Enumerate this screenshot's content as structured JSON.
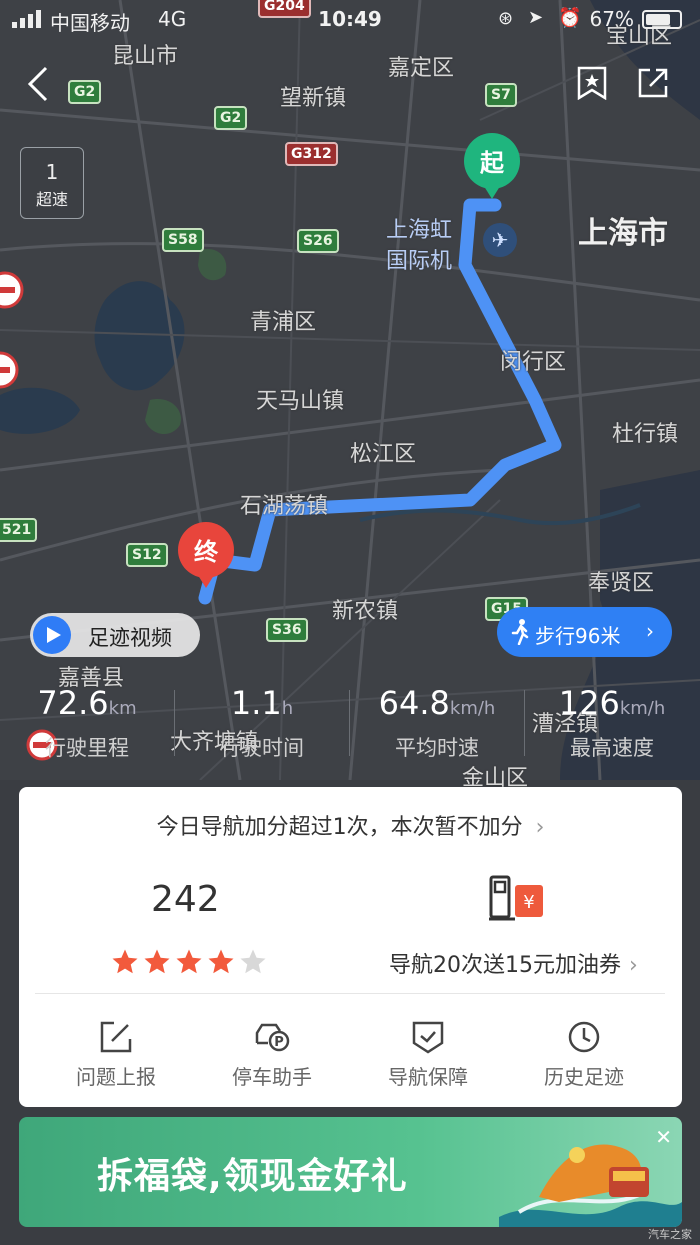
{
  "status_bar": {
    "carrier": "中国移动",
    "network": "4G",
    "time": "10:49",
    "battery": "67%"
  },
  "map": {
    "places": {
      "kunshan": "昆山市",
      "jiading": "嘉定区",
      "baoshan": "宝山区",
      "wangxin": "望新镇",
      "hongqiao_1": "上海虹",
      "hongqiao_2": "国际机",
      "shanghai": "上海市",
      "qingpu": "青浦区",
      "minhang": "闵行区",
      "tianmashan": "天马山镇",
      "songjiang": "松江区",
      "duhang": "杜行镇",
      "shihudang": "石湖荡镇",
      "xinnong": "新农镇",
      "fengxian": "奉贤区",
      "jiashan": "嘉善县",
      "daqiao": "大齐塘镇",
      "caojing": "漕泾镇",
      "jinshan": "金山区"
    },
    "highways": {
      "g2a": "G2",
      "g2b": "G2",
      "g204": "G204",
      "s7": "S7",
      "g312": "G312",
      "s58": "S58",
      "s26": "S26",
      "s521": "521",
      "s12": "S12",
      "s36": "S36",
      "g15": "G15"
    },
    "start_label": "起",
    "end_label": "终",
    "speed_box": {
      "count": "1",
      "label": "超速"
    },
    "video_pill": "足迹视频",
    "walk_pill": "步行96米"
  },
  "stats": [
    {
      "value": "72.6",
      "unit": "km",
      "label": "行驶里程"
    },
    {
      "value": "1.1",
      "unit": "h",
      "label": "行驶时间"
    },
    {
      "value": "64.8",
      "unit": "km/h",
      "label": "平均时速"
    },
    {
      "value": "126",
      "unit": "km/h",
      "label": "最高速度"
    }
  ],
  "card": {
    "notice": "今日导航加分超过1次，本次暂不加分",
    "score": "242",
    "stars_rating": 4,
    "stars_total": 5,
    "coupon": "导航20次送15元加油券",
    "tools": [
      {
        "label": "问题上报",
        "icon": "edit-report-icon"
      },
      {
        "label": "停车助手",
        "icon": "parking-car-icon"
      },
      {
        "label": "导航保障",
        "icon": "shield-check-icon"
      },
      {
        "label": "历史足迹",
        "icon": "clock-history-icon"
      }
    ]
  },
  "banner": {
    "text": "拆福袋,领现金好礼",
    "close": "✕"
  },
  "watermark": "汽车之家",
  "colors": {
    "route": "#4e92f5",
    "start_pin": "#1fb57e",
    "end_pin": "#e8453c",
    "accent_blue": "#2f80f4",
    "star_on": "#f25a3c",
    "star_off": "#d8d8d8"
  }
}
